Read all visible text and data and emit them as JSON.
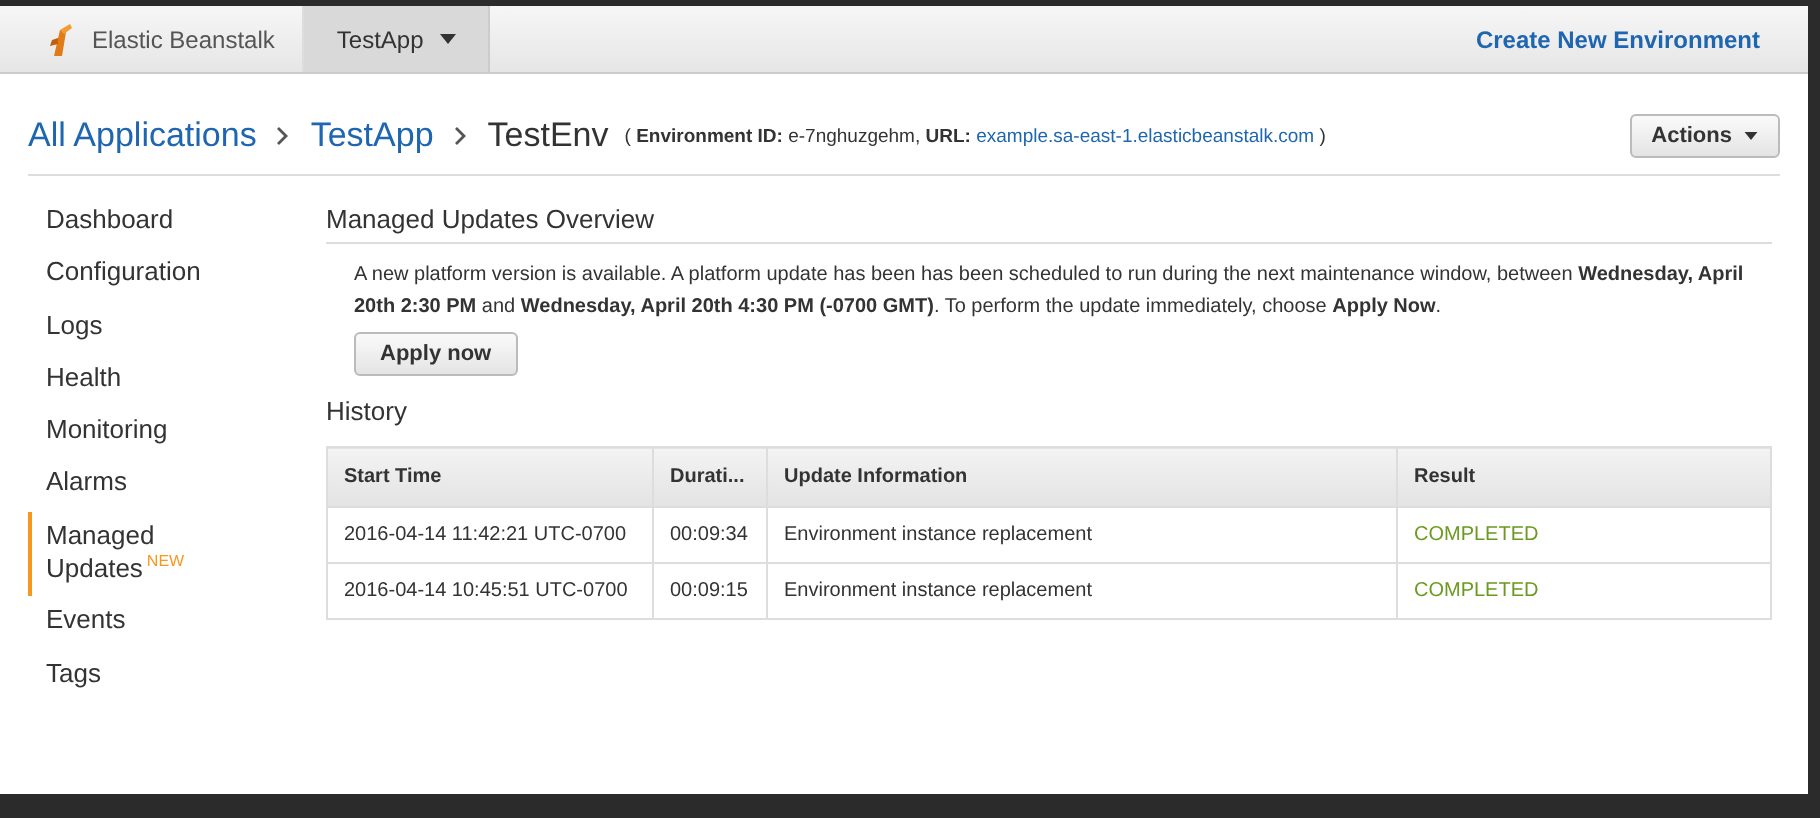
{
  "topbar": {
    "brand": "Elastic Beanstalk",
    "app_menu": {
      "label": "TestApp",
      "selected": true
    },
    "create_link": "Create New Environment"
  },
  "breadcrumb": {
    "items": [
      "All Applications",
      "TestApp"
    ],
    "current": "TestEnv",
    "env_id_label": "Environment ID:",
    "env_id": "e-7nghuzgehm,",
    "url_label": "URL:",
    "url": "example.sa-east-1.elasticbeanstalk.com",
    "open_paren": "(",
    "close_paren": ")"
  },
  "actions_button": "Actions",
  "sidebar": {
    "items": [
      {
        "label": "Dashboard",
        "selected": false
      },
      {
        "label": "Configuration",
        "selected": false
      },
      {
        "label": "Logs",
        "selected": false
      },
      {
        "label": "Health",
        "selected": false
      },
      {
        "label": "Monitoring",
        "selected": false
      },
      {
        "label": "Alarms",
        "selected": false
      },
      {
        "label": "Managed Updates",
        "badge": "NEW",
        "selected": true
      },
      {
        "label": "Events",
        "selected": false
      },
      {
        "label": "Tags",
        "selected": false
      }
    ]
  },
  "overview": {
    "title": "Managed Updates Overview",
    "message": "A new platform version is available. A platform update has been has been scheduled to run during the next maintenance window, between **Wednesday, April 20th 2:30 PM** and **Wednesday, April 20th 4:30 PM (-0700 GMT)**. To perform the update immediately, choose **Apply Now**.",
    "apply_button": "Apply now"
  },
  "history": {
    "title": "History",
    "table": {
      "columns": [
        "Start Time",
        "Durati...",
        "Update Information",
        "Result"
      ],
      "rows": [
        {
          "start_time": "2016-04-14 11:42:21 UTC-0700",
          "duration": "00:09:34",
          "info": "Environment instance replacement",
          "result": "COMPLETED",
          "color": "#6a9a1f"
        },
        {
          "start_time": "2016-04-14 10:45:51 UTC-0700",
          "duration": "00:09:15",
          "info": "Environment instance replacement",
          "result": "COMPLETED",
          "color": "#6a9a1f"
        }
      ]
    }
  }
}
